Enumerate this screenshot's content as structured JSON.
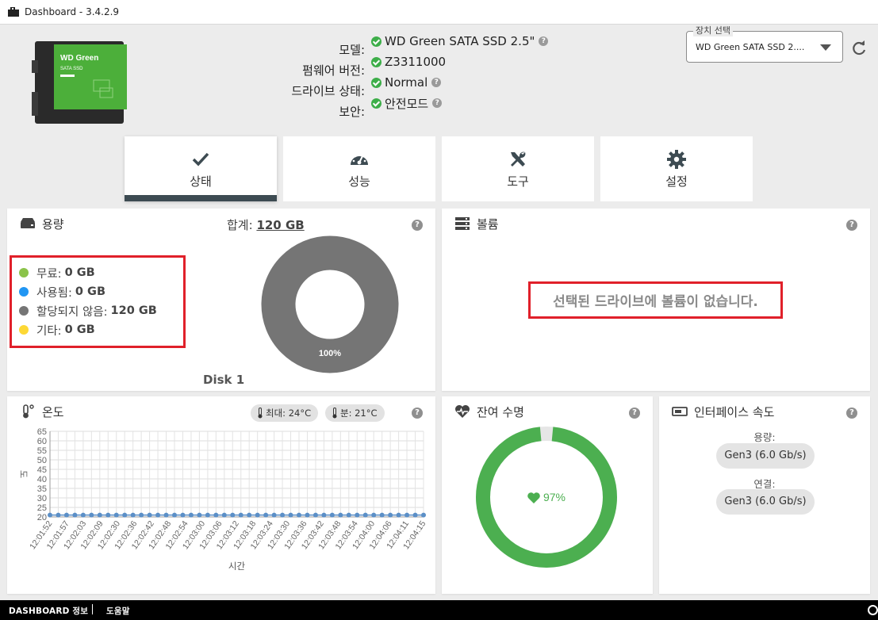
{
  "window": {
    "title": "Dashboard - 3.4.2.9"
  },
  "device": {
    "image_label_brand": "WD Green",
    "image_label_type": "SATA SSD",
    "rows": [
      {
        "label": "모델:",
        "value": "WD Green SATA SSD 2.5\"",
        "help": true
      },
      {
        "label": "펌웨어 버전:",
        "value": "Z3311000",
        "help": false
      },
      {
        "label": "드라이브 상태:",
        "value": "Normal",
        "help": true
      },
      {
        "label": "보안:",
        "value": "안전모드",
        "help": true
      }
    ],
    "status_color": "#3dae49"
  },
  "device_select": {
    "legend": "장치 선택",
    "value": "WD Green SATA SSD 2...."
  },
  "tabs": [
    {
      "label": "상태",
      "icon": "checkmark-icon",
      "active": true
    },
    {
      "label": "성능",
      "icon": "speedometer-icon",
      "active": false
    },
    {
      "label": "도구",
      "icon": "tools-icon",
      "active": false
    },
    {
      "label": "설정",
      "icon": "gear-icon",
      "active": false
    }
  ],
  "capacity": {
    "title": "용량",
    "total_label": "합계:",
    "total_value": "120 GB",
    "legend": [
      {
        "label": "무료:",
        "value": "0 GB",
        "color": "#8bc34a"
      },
      {
        "label": "사용됨:",
        "value": "0 GB",
        "color": "#2196f3"
      },
      {
        "label": "할당되지 않음:",
        "value": "120 GB",
        "color": "#757575"
      },
      {
        "label": "기타:",
        "value": "0 GB",
        "color": "#fdd835"
      }
    ],
    "donut_label": "100%",
    "disk_label": "Disk 1",
    "donut_color": "#757575"
  },
  "volume": {
    "title": "볼륨",
    "empty_message": "선택된 드라이브에 볼륨이 없습니다."
  },
  "temperature": {
    "title": "온도",
    "max_label": "최대: 24°C",
    "min_label": "분: 21°C"
  },
  "chart_data": {
    "type": "line",
    "ylabel": "도",
    "xlabel": "시간",
    "ylim": [
      20,
      65
    ],
    "yticks": [
      20,
      25,
      30,
      35,
      40,
      45,
      50,
      55,
      60,
      65
    ],
    "xticks": [
      "12:01:52",
      "12:01:57",
      "12:02:03",
      "12:02:09",
      "12:02:30",
      "12:02:36",
      "12:02:42",
      "12:02:48",
      "12:02:54",
      "12:03:00",
      "12:03:06",
      "12:03:12",
      "12:03:18",
      "12:03:24",
      "12:03:30",
      "12:03:36",
      "12:03:42",
      "12:03:48",
      "12:03:54",
      "12:04:00",
      "12:04:06",
      "12:04:11",
      "12:04:15"
    ],
    "series": [
      {
        "values": [
          21,
          21,
          21,
          21,
          21,
          21,
          21,
          21,
          21,
          21,
          21,
          21,
          21,
          21,
          21,
          21,
          21,
          21,
          21,
          21,
          21,
          21,
          21,
          21,
          21,
          21,
          21,
          21,
          21,
          21,
          21,
          21,
          21,
          21,
          21,
          21,
          21,
          21,
          21,
          21,
          21,
          21,
          21,
          21,
          21,
          21
        ],
        "color": "#5b8fc7"
      }
    ],
    "grid": true
  },
  "life": {
    "title": "잔여 수명",
    "percent_label": "97%",
    "percent": 97,
    "color": "#4caf50"
  },
  "interface": {
    "title": "인터페이스 속도",
    "capacity_label": "용량:",
    "capacity_value": "Gen3 (6.0 Gb/s)",
    "connection_label": "연결:",
    "connection_value": "Gen3 (6.0 Gb/s)"
  },
  "footer": {
    "about": "DASHBOARD 정보",
    "help": "도움말"
  },
  "help_glyph": "?"
}
